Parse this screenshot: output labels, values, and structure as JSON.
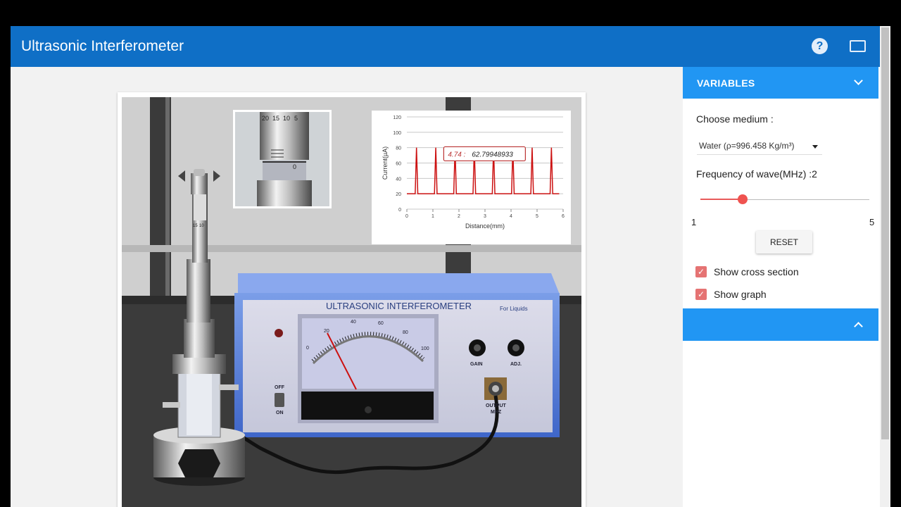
{
  "app": {
    "title": "Ultrasonic Interferometer",
    "icons": {
      "help": "help-circle-icon",
      "fullscreen": "fullscreen-icon"
    },
    "colors": {
      "header": "#0f6fc6",
      "panel_header": "#2196f3",
      "accent": "#ef5350"
    }
  },
  "sidebar": {
    "section_title": "VARIABLES",
    "medium_label": "Choose medium :",
    "medium_value": "Water (ρ=996.458 Kg/m³)",
    "frequency_label": "Frequency of wave(MHz) :2",
    "slider": {
      "min": "1",
      "max": "5",
      "value": 2
    },
    "reset_label": "RESET",
    "checkboxes": [
      {
        "label": "Show cross section",
        "checked": true
      },
      {
        "label": "Show graph",
        "checked": true
      }
    ]
  },
  "apparatus": {
    "panel_title": "ULTRASONIC INTERFEROMETER",
    "panel_subtitle": "For Liquids",
    "switch_off": "OFF",
    "switch_on": "ON",
    "knob_gain": "GAIN",
    "knob_adj": "ADJ.",
    "output_label": "OUTPUT",
    "output_sub": "MHZ",
    "meter_scale": [
      "0",
      "20",
      "40",
      "60",
      "80",
      "100"
    ],
    "meter_value": 20,
    "micrometer_ticks": [
      "20",
      "15",
      "10",
      "5",
      "0"
    ],
    "small_micrometer_ticks": [
      "15",
      "10"
    ]
  },
  "chart_data": {
    "type": "line",
    "xlabel": "Distance(mm)",
    "ylabel": "Current(µA)",
    "xlim": [
      0,
      6
    ],
    "ylim": [
      0,
      120
    ],
    "xticks": [
      "0",
      "1",
      "2",
      "3",
      "4",
      "5",
      "6"
    ],
    "yticks": [
      "0",
      "20",
      "40",
      "60",
      "80",
      "100",
      "120"
    ],
    "baseline": 20,
    "peak_positions": [
      0.37,
      1.11,
      1.85,
      2.59,
      3.33,
      4.07,
      4.81,
      5.55
    ],
    "peak_value": 80,
    "tooltip": {
      "x": "4.74",
      "y": "62.79948933",
      "separator": ":"
    },
    "series_color": "#cc1111"
  }
}
